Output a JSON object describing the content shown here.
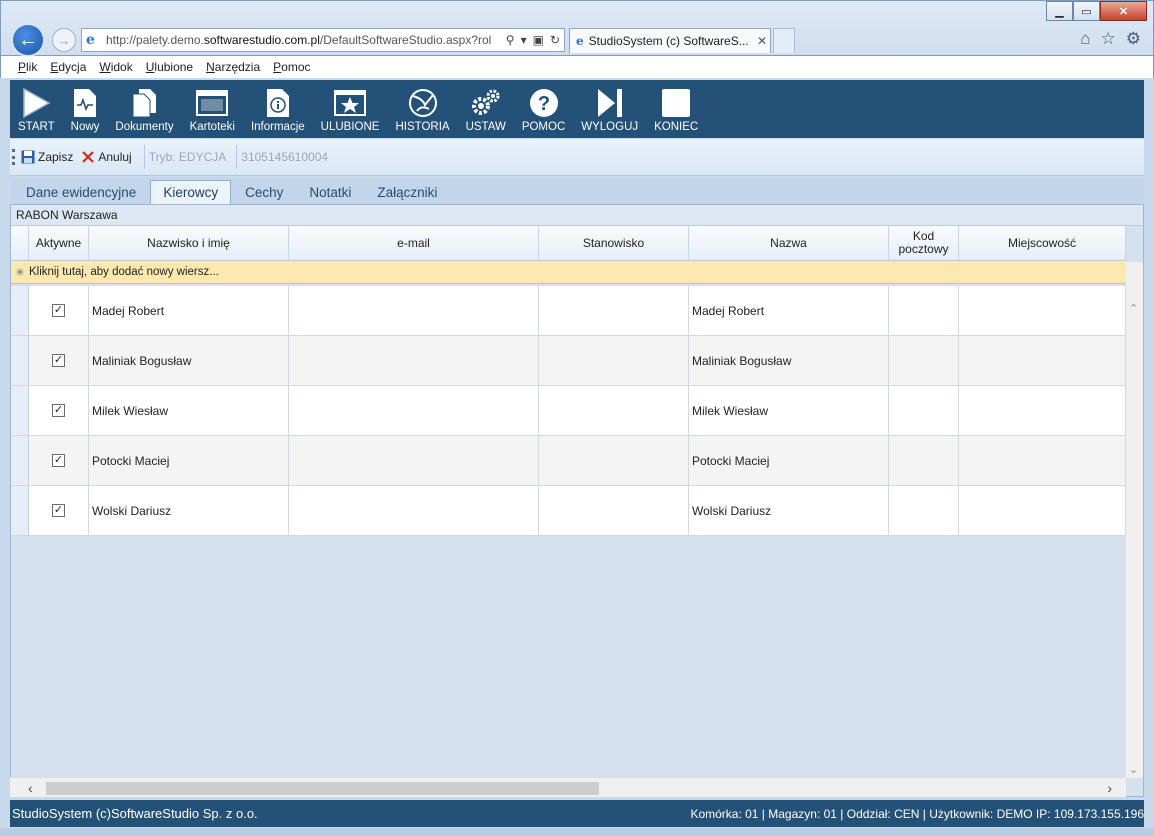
{
  "browser": {
    "url_prefix": "http://palety.demo.",
    "url_domain": "softwarestudio.com.pl",
    "url_suffix": "/DefaultSoftwareStudio.aspx?rol",
    "tab_title": "StudioSystem (c) SoftwareS...",
    "window_controls": {
      "min": "▁",
      "max": "▭",
      "close": "✕"
    }
  },
  "menu": [
    "Plik",
    "Edycja",
    "Widok",
    "Ulubione",
    "Narzędzia",
    "Pomoc"
  ],
  "toolbar": [
    {
      "label": "START",
      "icon": "play-icon"
    },
    {
      "label": "Nowy",
      "icon": "new-document-icon"
    },
    {
      "label": "Dokumenty",
      "icon": "documents-icon"
    },
    {
      "label": "Kartoteki",
      "icon": "window-icon"
    },
    {
      "label": "Informacje",
      "icon": "info-icon"
    },
    {
      "label": "ULUBIONE",
      "icon": "star-icon"
    },
    {
      "label": "HISTORIA",
      "icon": "history-icon"
    },
    {
      "label": "USTAW",
      "icon": "gears-icon"
    },
    {
      "label": "POMOC",
      "icon": "help-icon"
    },
    {
      "label": "WYLOGUJ",
      "icon": "logout-icon"
    },
    {
      "label": "KONIEC",
      "icon": "stop-icon"
    }
  ],
  "editbar": {
    "save": "Zapisz",
    "cancel": "Anuluj",
    "mode": "Tryb: EDYCJA",
    "record_id": "3105145610004"
  },
  "tabs": [
    "Dane ewidencyjne",
    "Kierowcy",
    "Cechy",
    "Notatki",
    "Załączniki"
  ],
  "active_tab": "Kierowcy",
  "group_label": "RABON Warszawa",
  "grid": {
    "columns": [
      "Aktywne",
      "Nazwisko i imię",
      "e-mail",
      "Stanowisko",
      "Nazwa",
      "Kod pocztowy",
      "Miejscowość"
    ],
    "new_row": "Kliknij tutaj, aby dodać nowy wiersz...",
    "rows": [
      {
        "active": true,
        "name": "Madej Robert",
        "email": "",
        "position": "",
        "display": "Madej Robert",
        "zip": "",
        "city": ""
      },
      {
        "active": true,
        "name": "Maliniak Bogusław",
        "email": "",
        "position": "",
        "display": "Maliniak Bogusław",
        "zip": "",
        "city": ""
      },
      {
        "active": true,
        "name": "Milek Wiesław",
        "email": "",
        "position": "",
        "display": "Milek Wiesław",
        "zip": "",
        "city": ""
      },
      {
        "active": true,
        "name": "Potocki Maciej",
        "email": "",
        "position": "",
        "display": "Potocki Maciej",
        "zip": "",
        "city": ""
      },
      {
        "active": true,
        "name": "Wolski Dariusz",
        "email": "",
        "position": "",
        "display": "Wolski Dariusz",
        "zip": "",
        "city": ""
      }
    ]
  },
  "status": {
    "left": "StudioSystem (c)SoftwareStudio Sp. z o.o.",
    "right": "Komórka: 01 | Magazyn: 01 | Oddział: CEN | Użytkownik: DEMO IP: 109.173.155.196"
  }
}
